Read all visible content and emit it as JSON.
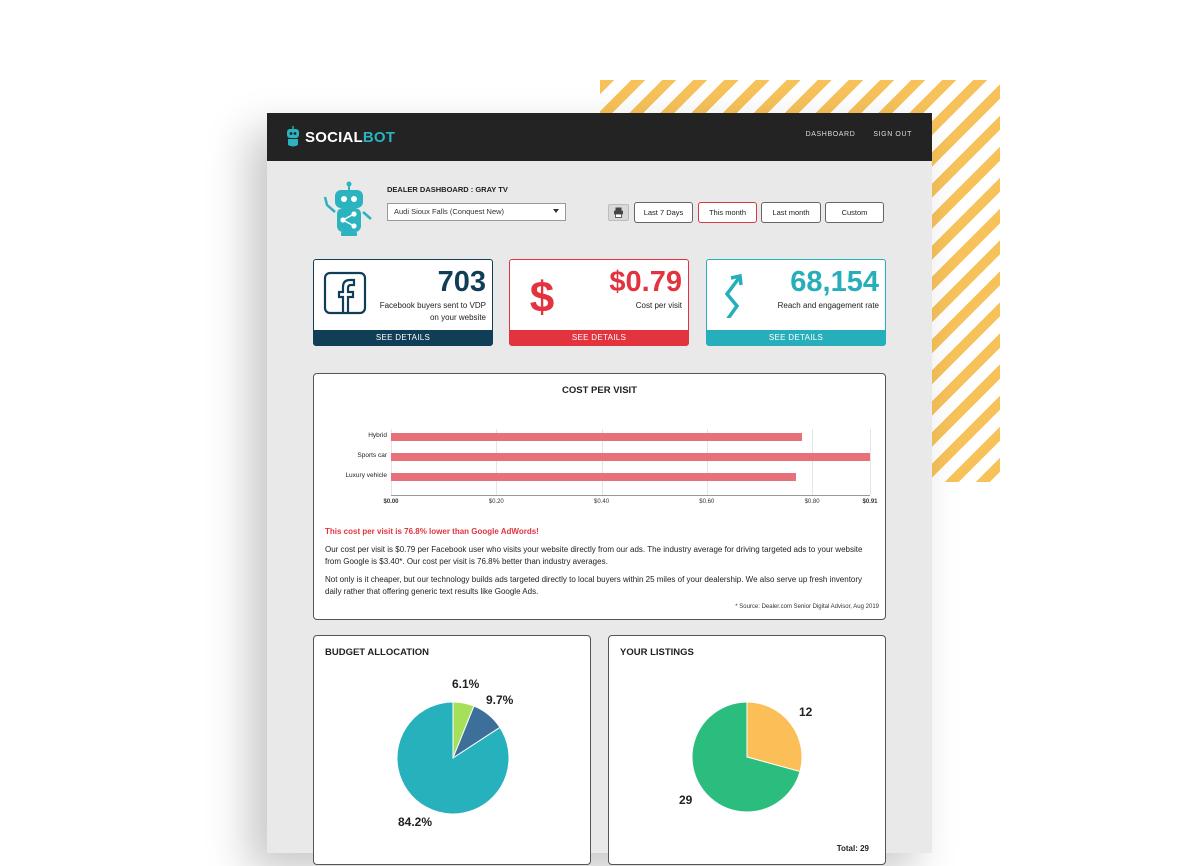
{
  "app": {
    "logo_social": "SOCIAL",
    "logo_bot": "BOT",
    "nav": [
      "DASHBOARD",
      "SIGN OUT"
    ]
  },
  "header": {
    "title": "DEALER DASHBOARD : GRAY TV",
    "dealer_selected": "Audi Sioux Falls (Conquest New)",
    "ranges": [
      "Last 7 Days",
      "This month",
      "Last month",
      "Custom"
    ],
    "active_range": "This month"
  },
  "kpis": [
    {
      "value": "703",
      "label": "Facebook buyers sent to VDP on your website",
      "footer": "SEE DETAILS",
      "color": "#103e57",
      "icon": "facebook-icon"
    },
    {
      "value": "$0.79",
      "label": "Cost per visit",
      "footer": "SEE DETAILS",
      "color": "#e2333e",
      "icon": "dollar-icon"
    },
    {
      "value": "68,154",
      "label": "Reach and engagement rate",
      "footer": "SEE DETAILS",
      "color": "#27aebb",
      "icon": "zigzag-arrow-icon"
    }
  ],
  "cost_per_visit": {
    "title": "COST PER VISIT",
    "highlight": "This cost per visit is 76.8% lower than Google AdWords!",
    "para1": "Our cost per visit is $0.79 per Facebook user who visits your website directly from our ads. The industry average for driving targeted ads to your website from Google is $3.40*. Our cost per visit is 76.8% better than industry averages.",
    "para2": "Not only is it cheaper, but our technology builds ads targeted directly to local buyers within 25 miles of your dealership. We also serve up fresh inventory daily rather that offering generic text results like Google Ads.",
    "source": "* Source: Dealer.com Senior Digital Advisor, Aug 2019"
  },
  "budget": {
    "title": "BUDGET ALLOCATION"
  },
  "listings": {
    "title": "YOUR LISTINGS",
    "total": "Total: 29"
  },
  "chart_data": [
    {
      "type": "bar",
      "orientation": "horizontal",
      "title": "COST PER VISIT",
      "categories": [
        "Hybrid",
        "Sports car",
        "Luxury vehicle"
      ],
      "values": [
        0.78,
        0.91,
        0.77
      ],
      "xlim": [
        0,
        0.91
      ],
      "ticks": [
        "$0.00",
        "$0.20",
        "$0.40",
        "$0.60",
        "$0.80",
        "$0.91"
      ],
      "tick_values": [
        0,
        0.2,
        0.4,
        0.6,
        0.8,
        0.91
      ],
      "color": "#e8707a",
      "grid": true
    },
    {
      "type": "pie",
      "title": "BUDGET ALLOCATION",
      "labels": [
        "6.1%",
        "9.7%",
        "84.2%"
      ],
      "values": [
        6.1,
        9.7,
        84.2
      ],
      "colors": [
        "#a6df5a",
        "#3d6f9b",
        "#27b1bc"
      ]
    },
    {
      "type": "pie",
      "title": "YOUR LISTINGS",
      "labels": [
        "12",
        "29"
      ],
      "values": [
        12,
        29
      ],
      "colors": [
        "#fcbf58",
        "#2bbd7e"
      ]
    }
  ]
}
